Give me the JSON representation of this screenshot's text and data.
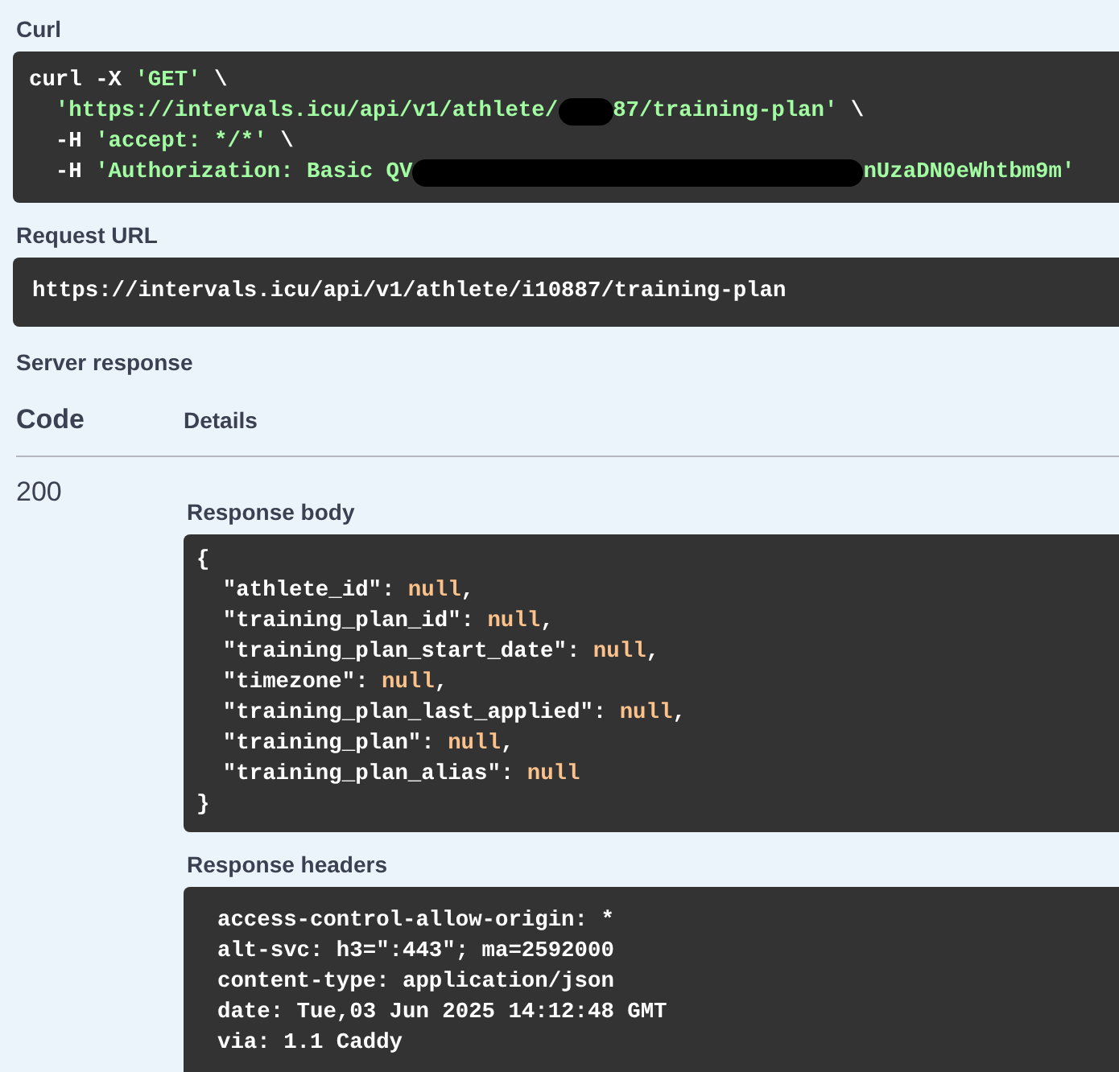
{
  "curl": {
    "label": "Curl",
    "lines": [
      [
        {
          "kind": "plain",
          "text": "curl -X "
        },
        {
          "kind": "string",
          "text": "'GET'"
        },
        {
          "kind": "plain",
          "text": " \\"
        }
      ],
      [
        {
          "kind": "string",
          "text": "  'https://intervals.icu/api/v1/athlete/"
        },
        {
          "kind": "redacted_short"
        },
        {
          "kind": "string",
          "text": "87/training-plan'"
        },
        {
          "kind": "plain",
          "text": " \\"
        }
      ],
      [
        {
          "kind": "plain",
          "text": "  -H "
        },
        {
          "kind": "string",
          "text": "'accept: */*'"
        },
        {
          "kind": "plain",
          "text": " \\"
        }
      ],
      [
        {
          "kind": "plain",
          "text": "  -H "
        },
        {
          "kind": "string",
          "text": "'Authorization: Basic QV"
        },
        {
          "kind": "redacted_long"
        },
        {
          "kind": "string",
          "text": "nUzaDN0eWhtbm9m'"
        }
      ]
    ]
  },
  "request_url": {
    "label": "Request URL",
    "value": "https://intervals.icu/api/v1/athlete/i10887/training-plan"
  },
  "server_response": {
    "label": "Server response",
    "columns": [
      "Code",
      "Details"
    ],
    "code": "200",
    "body": {
      "label": "Response body",
      "lines": [
        [
          {
            "kind": "plain",
            "text": "{"
          }
        ],
        [
          {
            "kind": "plain",
            "text": "  \"athlete_id\": "
          },
          {
            "kind": "literal",
            "text": "null"
          },
          {
            "kind": "plain",
            "text": ","
          }
        ],
        [
          {
            "kind": "plain",
            "text": "  \"training_plan_id\": "
          },
          {
            "kind": "literal",
            "text": "null"
          },
          {
            "kind": "plain",
            "text": ","
          }
        ],
        [
          {
            "kind": "plain",
            "text": "  \"training_plan_start_date\": "
          },
          {
            "kind": "literal",
            "text": "null"
          },
          {
            "kind": "plain",
            "text": ","
          }
        ],
        [
          {
            "kind": "plain",
            "text": "  \"timezone\": "
          },
          {
            "kind": "literal",
            "text": "null"
          },
          {
            "kind": "plain",
            "text": ","
          }
        ],
        [
          {
            "kind": "plain",
            "text": "  \"training_plan_last_applied\": "
          },
          {
            "kind": "literal",
            "text": "null"
          },
          {
            "kind": "plain",
            "text": ","
          }
        ],
        [
          {
            "kind": "plain",
            "text": "  \"training_plan\": "
          },
          {
            "kind": "literal",
            "text": "null"
          },
          {
            "kind": "plain",
            "text": ","
          }
        ],
        [
          {
            "kind": "plain",
            "text": "  \"training_plan_alias\": "
          },
          {
            "kind": "literal",
            "text": "null"
          }
        ],
        [
          {
            "kind": "plain",
            "text": "}"
          }
        ]
      ]
    },
    "headers": {
      "label": "Response headers",
      "lines": [
        "access-control-allow-origin: *",
        "alt-svc: h3=\":443\"; ma=2592000",
        "content-type: application/json",
        "date: Tue,03 Jun 2025 14:12:48 GMT",
        "via: 1.1 Caddy"
      ]
    }
  }
}
